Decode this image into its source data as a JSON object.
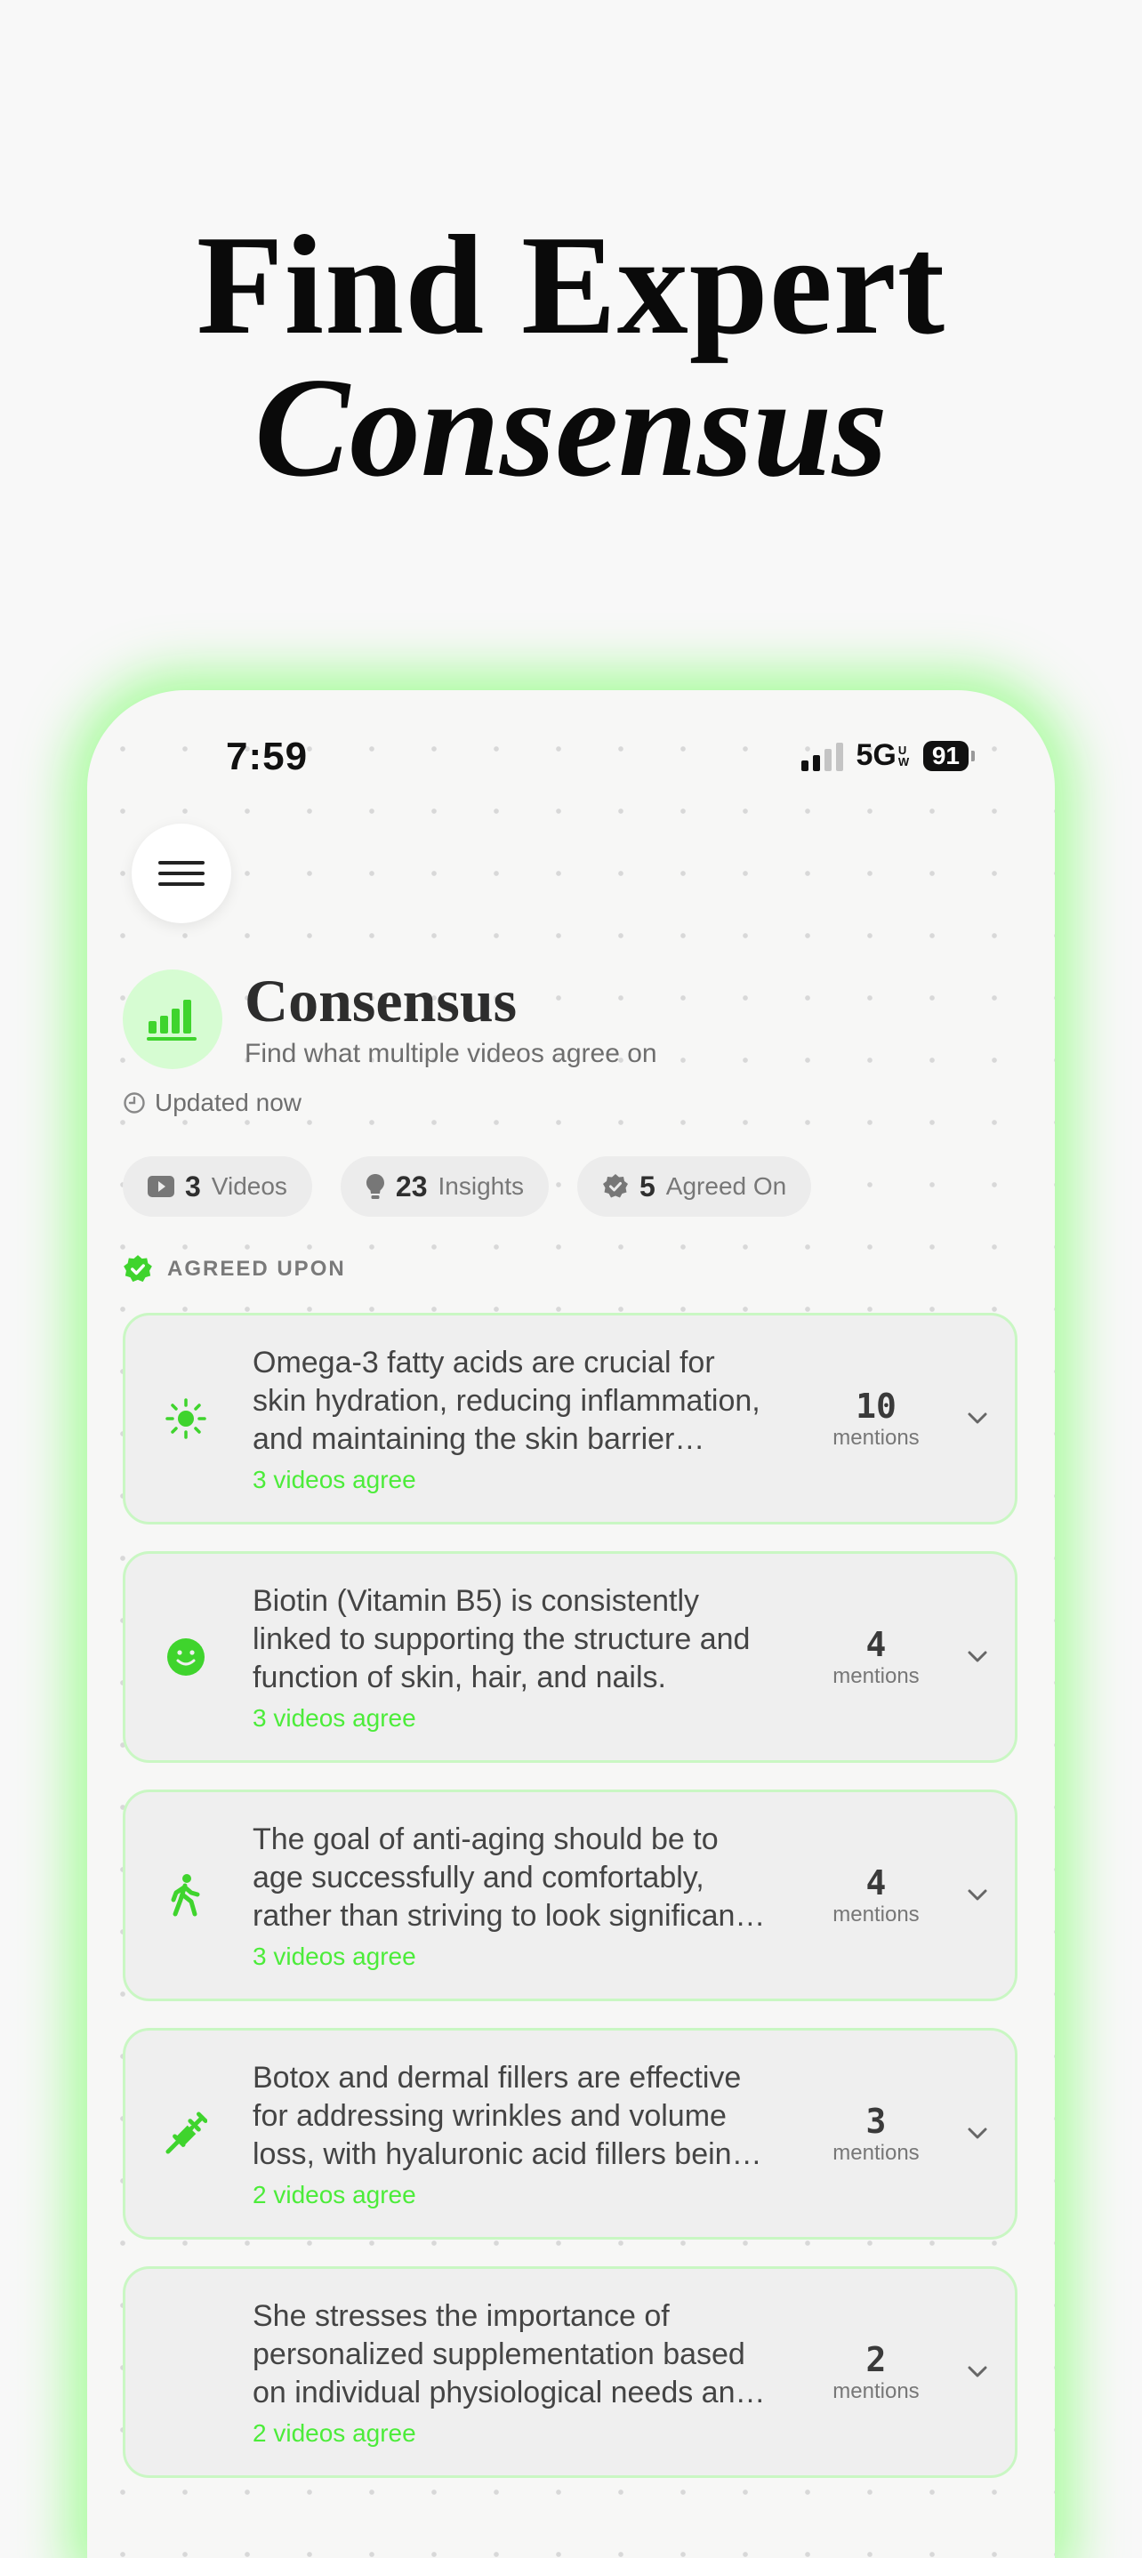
{
  "headline": {
    "line1": "Find Expert",
    "line2": "Consensus"
  },
  "status_bar": {
    "time": "7:59",
    "network": "5G",
    "network_badge": "UW",
    "battery": "91"
  },
  "app": {
    "title": "Consensus",
    "subtitle": "Find what multiple videos agree on",
    "updated": "Updated now"
  },
  "chips": [
    {
      "icon": "play-icon",
      "count": "3",
      "label": "Videos"
    },
    {
      "icon": "lightbulb-icon",
      "count": "23",
      "label": "Insights"
    },
    {
      "icon": "verified-badge-icon",
      "count": "5",
      "label": "Agreed On"
    }
  ],
  "section_label": "AGREED UPON",
  "cards": [
    {
      "icon": "sun-icon",
      "claim": "Omega-3 fatty acids are crucial for skin hydration, reducing inflammation, and maintaining the skin barrier function.",
      "agree": "3 videos agree",
      "count": "10",
      "unit": "mentions"
    },
    {
      "icon": "smiley-icon",
      "claim": "Biotin (Vitamin B5) is consistently linked to supporting the structure and function of skin, hair, and nails.",
      "agree": "3 videos agree",
      "count": "4",
      "unit": "mentions"
    },
    {
      "icon": "walking-icon",
      "claim": "The goal of anti-aging should be to age successfully and comfortably, rather than striving to look significantly younger.",
      "agree": "3 videos agree",
      "count": "4",
      "unit": "mentions"
    },
    {
      "icon": "syringe-icon",
      "claim": "Botox and dermal fillers are effective for addressing wrinkles and volume loss, with hyaluronic acid fillers being the most common.",
      "agree": "2 videos agree",
      "count": "3",
      "unit": "mentions"
    },
    {
      "icon": "none",
      "claim": "She stresses the importance of personalized supplementation based on individual physiological needs and deficiencies.",
      "agree": "2 videos agree",
      "count": "2",
      "unit": "mentions"
    }
  ],
  "colors": {
    "accent": "#4cec3a",
    "glow": "#6eff5a",
    "card_border": "#c9f7c3"
  }
}
